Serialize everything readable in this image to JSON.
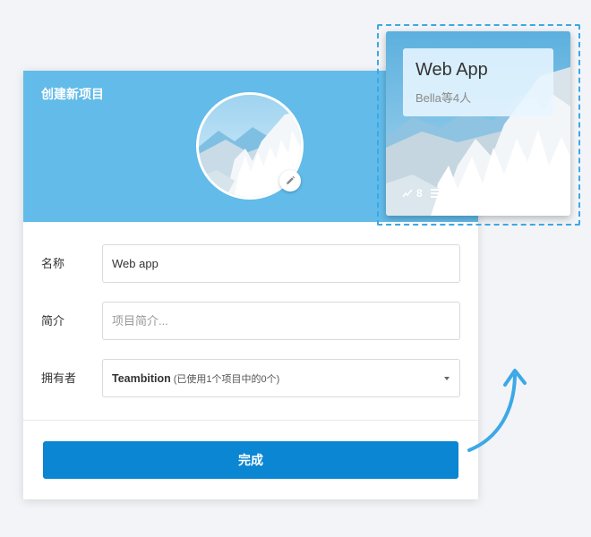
{
  "dialog": {
    "title": "创建新项目",
    "fields": {
      "name_label": "名称",
      "name_value": "Web app",
      "intro_label": "简介",
      "intro_placeholder": "项目简介...",
      "owner_label": "拥有者",
      "owner_value": "Teambition",
      "owner_note": "(已使用1个项目中的0个)"
    },
    "done_label": "完成"
  },
  "card": {
    "title": "Web App",
    "members": "Bella等4人",
    "stats": {
      "activity": "8",
      "tasks": "27",
      "files": "3"
    }
  },
  "colors": {
    "header": "#62bbe9",
    "primary_button": "#0a86d2",
    "dashed_outline": "#3da8e6",
    "background": "#f2f4f7"
  },
  "icons": {
    "edit": "pencil-icon",
    "activity": "trend-icon",
    "tasks": "list-icon",
    "files": "file-icon",
    "select": "caret-down-icon"
  }
}
